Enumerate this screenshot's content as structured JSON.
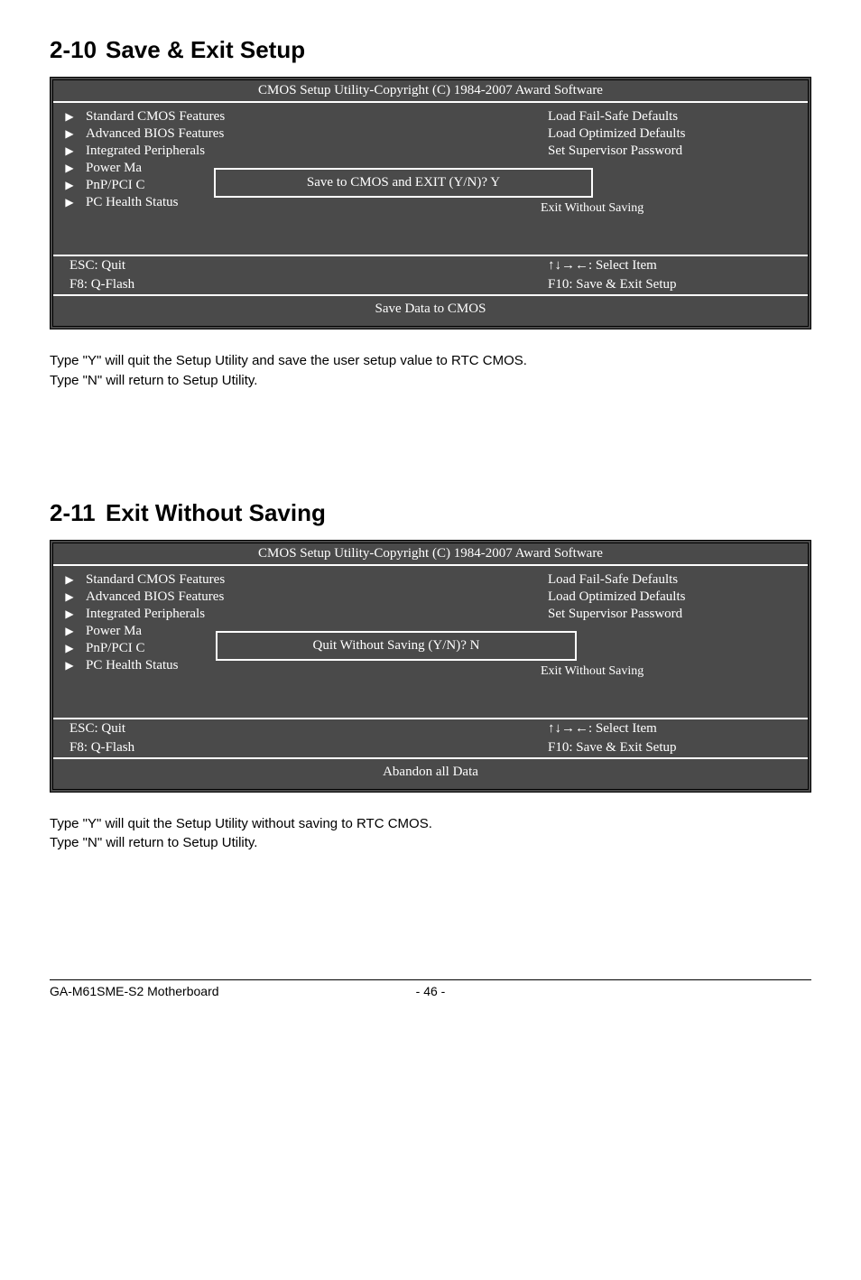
{
  "sections": {
    "save": {
      "num": "2-10",
      "title": "Save & Exit Setup"
    },
    "exit": {
      "num": "2-11",
      "title": "Exit Without Saving"
    }
  },
  "bios": {
    "title": "CMOS Setup Utility-Copyright (C) 1984-2007 Award Software",
    "left_items": [
      "Standard CMOS Features",
      "Advanced BIOS Features",
      "Integrated Peripherals",
      "Power Ma",
      "PnP/PCI C",
      "PC Health Status"
    ],
    "right_items": [
      "Load Fail-Safe Defaults",
      "Load Optimized Defaults",
      "Set Supervisor Password"
    ],
    "exit_behind": "Exit Without Saving",
    "dialog_save": "Save to CMOS and EXIT (Y/N)? Y",
    "dialog_quit": "Quit Without Saving (Y/N)? N",
    "esc": "ESC: Quit",
    "select": "↑↓→←: Select Item",
    "f8": "F8: Q-Flash",
    "f10": "F10: Save & Exit Setup",
    "footer_save": "Save Data to CMOS",
    "footer_exit": "Abandon all Data"
  },
  "para": {
    "save_l1": "Type \"Y\" will quit the Setup Utility and save the user setup value to RTC CMOS.",
    "save_l2": "Type \"N\" will return to Setup Utility.",
    "exit_l1": "Type \"Y\" will quit the Setup Utility without saving to RTC CMOS.",
    "exit_l2": "Type \"N\" will return to Setup Utility."
  },
  "page_footer": {
    "left": "GA-M61SME-S2 Motherboard",
    "center": "- 46 -"
  },
  "glyph": {
    "triangle": "▶"
  }
}
